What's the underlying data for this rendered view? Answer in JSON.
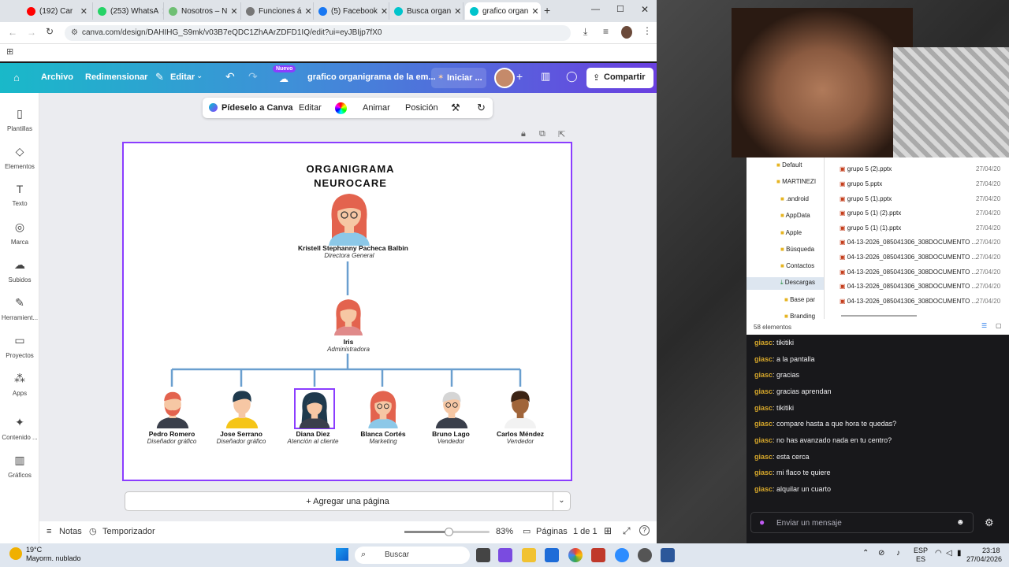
{
  "browser": {
    "tabs": [
      {
        "label": "(192) Car",
        "color": "#ff0000"
      },
      {
        "label": "(253) WhatsA",
        "color": "#25d366"
      },
      {
        "label": "Nosotros – N",
        "color": "#6fbf73"
      },
      {
        "label": "Funciones á",
        "color": "#777777"
      },
      {
        "label": "(5) Facebook",
        "color": "#1877f2"
      },
      {
        "label": "Busca organ",
        "color": "#00c4cc"
      },
      {
        "label": "grafico organ",
        "color": "#00c4cc"
      }
    ],
    "url": "canva.com/design/DAHIHG_S9mk/v03B7eQDC1ZhAArZDFD1IQ/edit?ui=eyJBIjp7fX0"
  },
  "canva_header": {
    "archivo": "Archivo",
    "redimensionar": "Redimensionar",
    "editar": "Editar",
    "nuevo_badge": "Nuevo",
    "title": "grafico organigrama de la em...",
    "iniciar": "Iniciar ...",
    "compartir": "Compartir"
  },
  "sidebar": {
    "items": [
      {
        "label": "Plantillas",
        "icon": "▯"
      },
      {
        "label": "Elementos",
        "icon": "◇"
      },
      {
        "label": "Texto",
        "icon": "T"
      },
      {
        "label": "Marca",
        "icon": "◎"
      },
      {
        "label": "Subidos",
        "icon": "☁"
      },
      {
        "label": "Herramient...",
        "icon": "✎"
      },
      {
        "label": "Proyectos",
        "icon": "▭"
      },
      {
        "label": "Apps",
        "icon": "⁂"
      },
      {
        "label": "Contenido ...",
        "icon": "✦"
      },
      {
        "label": "Gráficos",
        "icon": "▥"
      }
    ]
  },
  "context_toolbar": {
    "ask": "Pídeselo a Canva",
    "editar": "Editar",
    "animar": "Animar",
    "posicion": "Posición"
  },
  "org": {
    "title_line1": "ORGANIGRAMA",
    "title_line2": "NEUROCARE",
    "top": {
      "name": "Kristell Stephanny Pacheca Balbin",
      "role": "Directora General"
    },
    "mid": {
      "name": "Iris",
      "role": "Administradora"
    },
    "staff": [
      {
        "name": "Pedro Romero",
        "role": "Diseñador gráfico"
      },
      {
        "name": "Jose Serrano",
        "role": "Diseñador gráfico"
      },
      {
        "name": "Diana Diez",
        "role": "Atención al cliente"
      },
      {
        "name": "Blanca Cortés",
        "role": "Marketing"
      },
      {
        "name": "Bruno Lago",
        "role": "Vendedor"
      },
      {
        "name": "Carlos Méndez",
        "role": "Vendedor"
      }
    ]
  },
  "canvas_footer": {
    "add_page": "+ Agregar una página",
    "notas": "Notas",
    "temporizador": "Temporizador",
    "zoom": "83%",
    "paginas": "Páginas",
    "page_count": "1 de 1"
  },
  "explorer": {
    "folders": [
      ".android",
      "AppData",
      "Apple",
      "Búsqueda",
      "Contactos",
      "Descargas",
      "Base par",
      "Branding"
    ],
    "top_folders": [
      "Default",
      "MARTINEZI"
    ],
    "files": [
      {
        "name": "grupo 5 (2).pptx",
        "date": "27/04/20"
      },
      {
        "name": "grupo 5.pptx",
        "date": "27/04/20"
      },
      {
        "name": "grupo 5 (1).pptx",
        "date": "27/04/20"
      },
      {
        "name": "grupo 5 (1) (2).pptx",
        "date": "27/04/20"
      },
      {
        "name": "grupo 5 (1) (1).pptx",
        "date": "27/04/20"
      },
      {
        "name": "04-13-2026_085041306_308DOCUMENTO ...",
        "date": "27/04/20"
      },
      {
        "name": "04-13-2026_085041306_308DOCUMENTO ...",
        "date": "27/04/20"
      },
      {
        "name": "04-13-2026_085041306_308DOCUMENTO ...",
        "date": "27/04/20"
      },
      {
        "name": "04-13-2026_085041306_308DOCUMENTO ...",
        "date": "27/04/20"
      },
      {
        "name": "04-13-2026_085041306_308DOCUMENTO ...",
        "date": "27/04/20"
      }
    ],
    "status": "58 elementos"
  },
  "chat": {
    "messages": [
      {
        "user": "giasc",
        "text": ": tikitiki"
      },
      {
        "user": "giasc",
        "text": ": a la pantalla"
      },
      {
        "user": "giasc",
        "text": ": gracias"
      },
      {
        "user": "giasc",
        "text": ": gracias aprendan"
      },
      {
        "user": "giasc",
        "text": ": tikitiki"
      },
      {
        "user": "giasc",
        "text": ": compare hasta a que hora te quedas?"
      },
      {
        "user": "giasc",
        "text": ": no has avanzado nada en tu centro?"
      },
      {
        "user": "giasc",
        "text": ": esta cerca"
      },
      {
        "user": "giasc",
        "text": ": mi flaco te quiere"
      },
      {
        "user": "giasc",
        "text": ": alquilar un cuarto"
      }
    ],
    "placeholder": "Enviar un mensaje"
  },
  "taskbar": {
    "temp": "19°C",
    "weather": "Mayorm. nublado",
    "search": "Buscar",
    "lang1": "ESP",
    "lang2": "ES",
    "time": "23:18",
    "date": "27/04/2026"
  }
}
